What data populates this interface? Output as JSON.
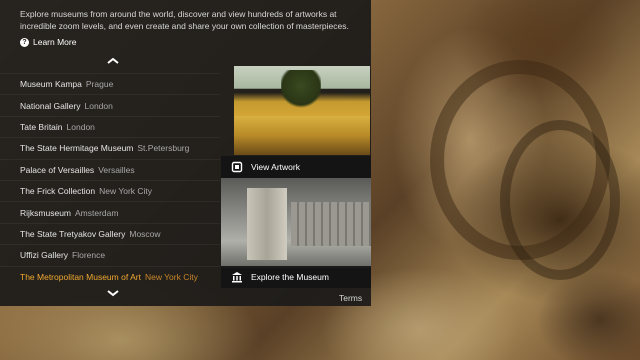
{
  "intro": {
    "text": "Explore museums from around the world, discover and view hundreds of artworks at incredible zoom levels, and even create and share your own collection of masterpieces.",
    "learn_more": "Learn More"
  },
  "museums": [
    {
      "name": "Museum Kampa",
      "city": "Prague",
      "selected": false
    },
    {
      "name": "National Gallery",
      "city": "London",
      "selected": false
    },
    {
      "name": "Tate Britain",
      "city": "London",
      "selected": false
    },
    {
      "name": "The State Hermitage Museum",
      "city": "St.Petersburg",
      "selected": false
    },
    {
      "name": "Palace of Versailles",
      "city": "Versailles",
      "selected": false
    },
    {
      "name": "The Frick Collection",
      "city": "New York City",
      "selected": false
    },
    {
      "name": "Rijksmuseum",
      "city": "Amsterdam",
      "selected": false
    },
    {
      "name": "The State Tretyakov Gallery",
      "city": "Moscow",
      "selected": false
    },
    {
      "name": "Uffizi Gallery",
      "city": "Florence",
      "selected": false
    },
    {
      "name": "The Metropolitan Museum of Art",
      "city": "New York City",
      "selected": true
    }
  ],
  "thumbs": {
    "artwork_label": "View Artwork",
    "museum_label": "Explore the Museum"
  },
  "footer": {
    "terms": "Terms"
  },
  "icons": {
    "help": "question-circle-icon",
    "scroll_up": "chevron-up-icon",
    "scroll_down": "chevron-down-icon",
    "artwork": "frame-icon",
    "museum": "building-icon"
  },
  "colors": {
    "panel_bg": "#1c1b1a",
    "selected_name": "#f0a830",
    "selected_city": "#c8862a",
    "text": "#e6e6e6",
    "muted_text": "#a8a8a8"
  }
}
